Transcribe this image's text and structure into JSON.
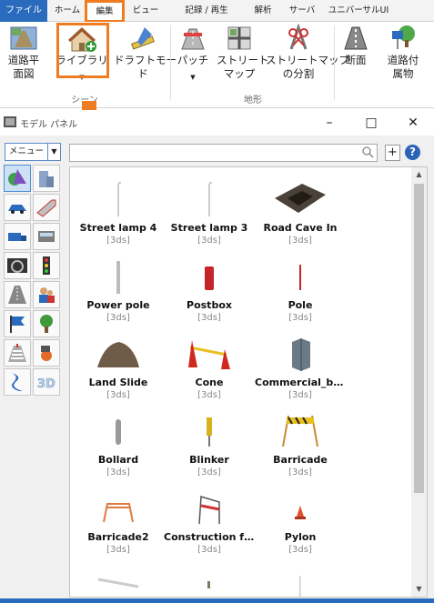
{
  "tabs": [
    "ファイル",
    "ホーム",
    "編集",
    "ビュー",
    "記録 / 再生",
    "解析",
    "サーバ",
    "ユニバーサルUI"
  ],
  "ribbon": {
    "buttons": {
      "road_plan": "道路平\n面図",
      "library": "ライブラリ",
      "draft_mode": "ドラフトモー\nド",
      "patch": "パッチ",
      "street_map": "ストリート\nマップ",
      "street_map_split": "ストリートマップ\nの分割",
      "section": "断面",
      "road_attachment": "道路付\n属物"
    },
    "groups": {
      "scene": "シーン",
      "terrain": "地形"
    }
  },
  "window": {
    "title": "モデル パネル"
  },
  "panel": {
    "menu_label": "メニュー",
    "search_placeholder": ""
  },
  "items": [
    {
      "name": "Street lamp 4",
      "ext": "[3ds]",
      "icon": "street-lamp-icon"
    },
    {
      "name": "Street lamp 3",
      "ext": "[3ds]",
      "icon": "street-lamp-icon"
    },
    {
      "name": "Road Cave In",
      "ext": "[3ds]",
      "icon": "road-cave-in-icon"
    },
    {
      "name": "Power pole",
      "ext": "[3ds]",
      "icon": "power-pole-icon"
    },
    {
      "name": "Postbox",
      "ext": "[3ds]",
      "icon": "postbox-icon"
    },
    {
      "name": "Pole",
      "ext": "[3ds]",
      "icon": "pole-icon"
    },
    {
      "name": "Land Slide",
      "ext": "[3ds]",
      "icon": "land-slide-icon"
    },
    {
      "name": "Cone",
      "ext": "[3ds]",
      "icon": "cone-icon"
    },
    {
      "name": "Commercial_bu...",
      "ext": "[3ds]",
      "icon": "building-icon"
    },
    {
      "name": "Bollard",
      "ext": "[3ds]",
      "icon": "bollard-icon"
    },
    {
      "name": "Blinker",
      "ext": "[3ds]",
      "icon": "blinker-icon"
    },
    {
      "name": "Barricade",
      "ext": "[3ds]",
      "icon": "barricade-icon"
    },
    {
      "name": "Barricade2",
      "ext": "[3ds]",
      "icon": "barricade2-icon"
    },
    {
      "name": "Construction fe...",
      "ext": "[3ds]",
      "icon": "construction-fence-icon"
    },
    {
      "name": "Pylon",
      "ext": "[3ds]",
      "icon": "pylon-icon"
    }
  ],
  "colors": {
    "file_tab": "#2a6bbd",
    "highlight": "#f07c22",
    "selected_category": "#cde0f5"
  }
}
